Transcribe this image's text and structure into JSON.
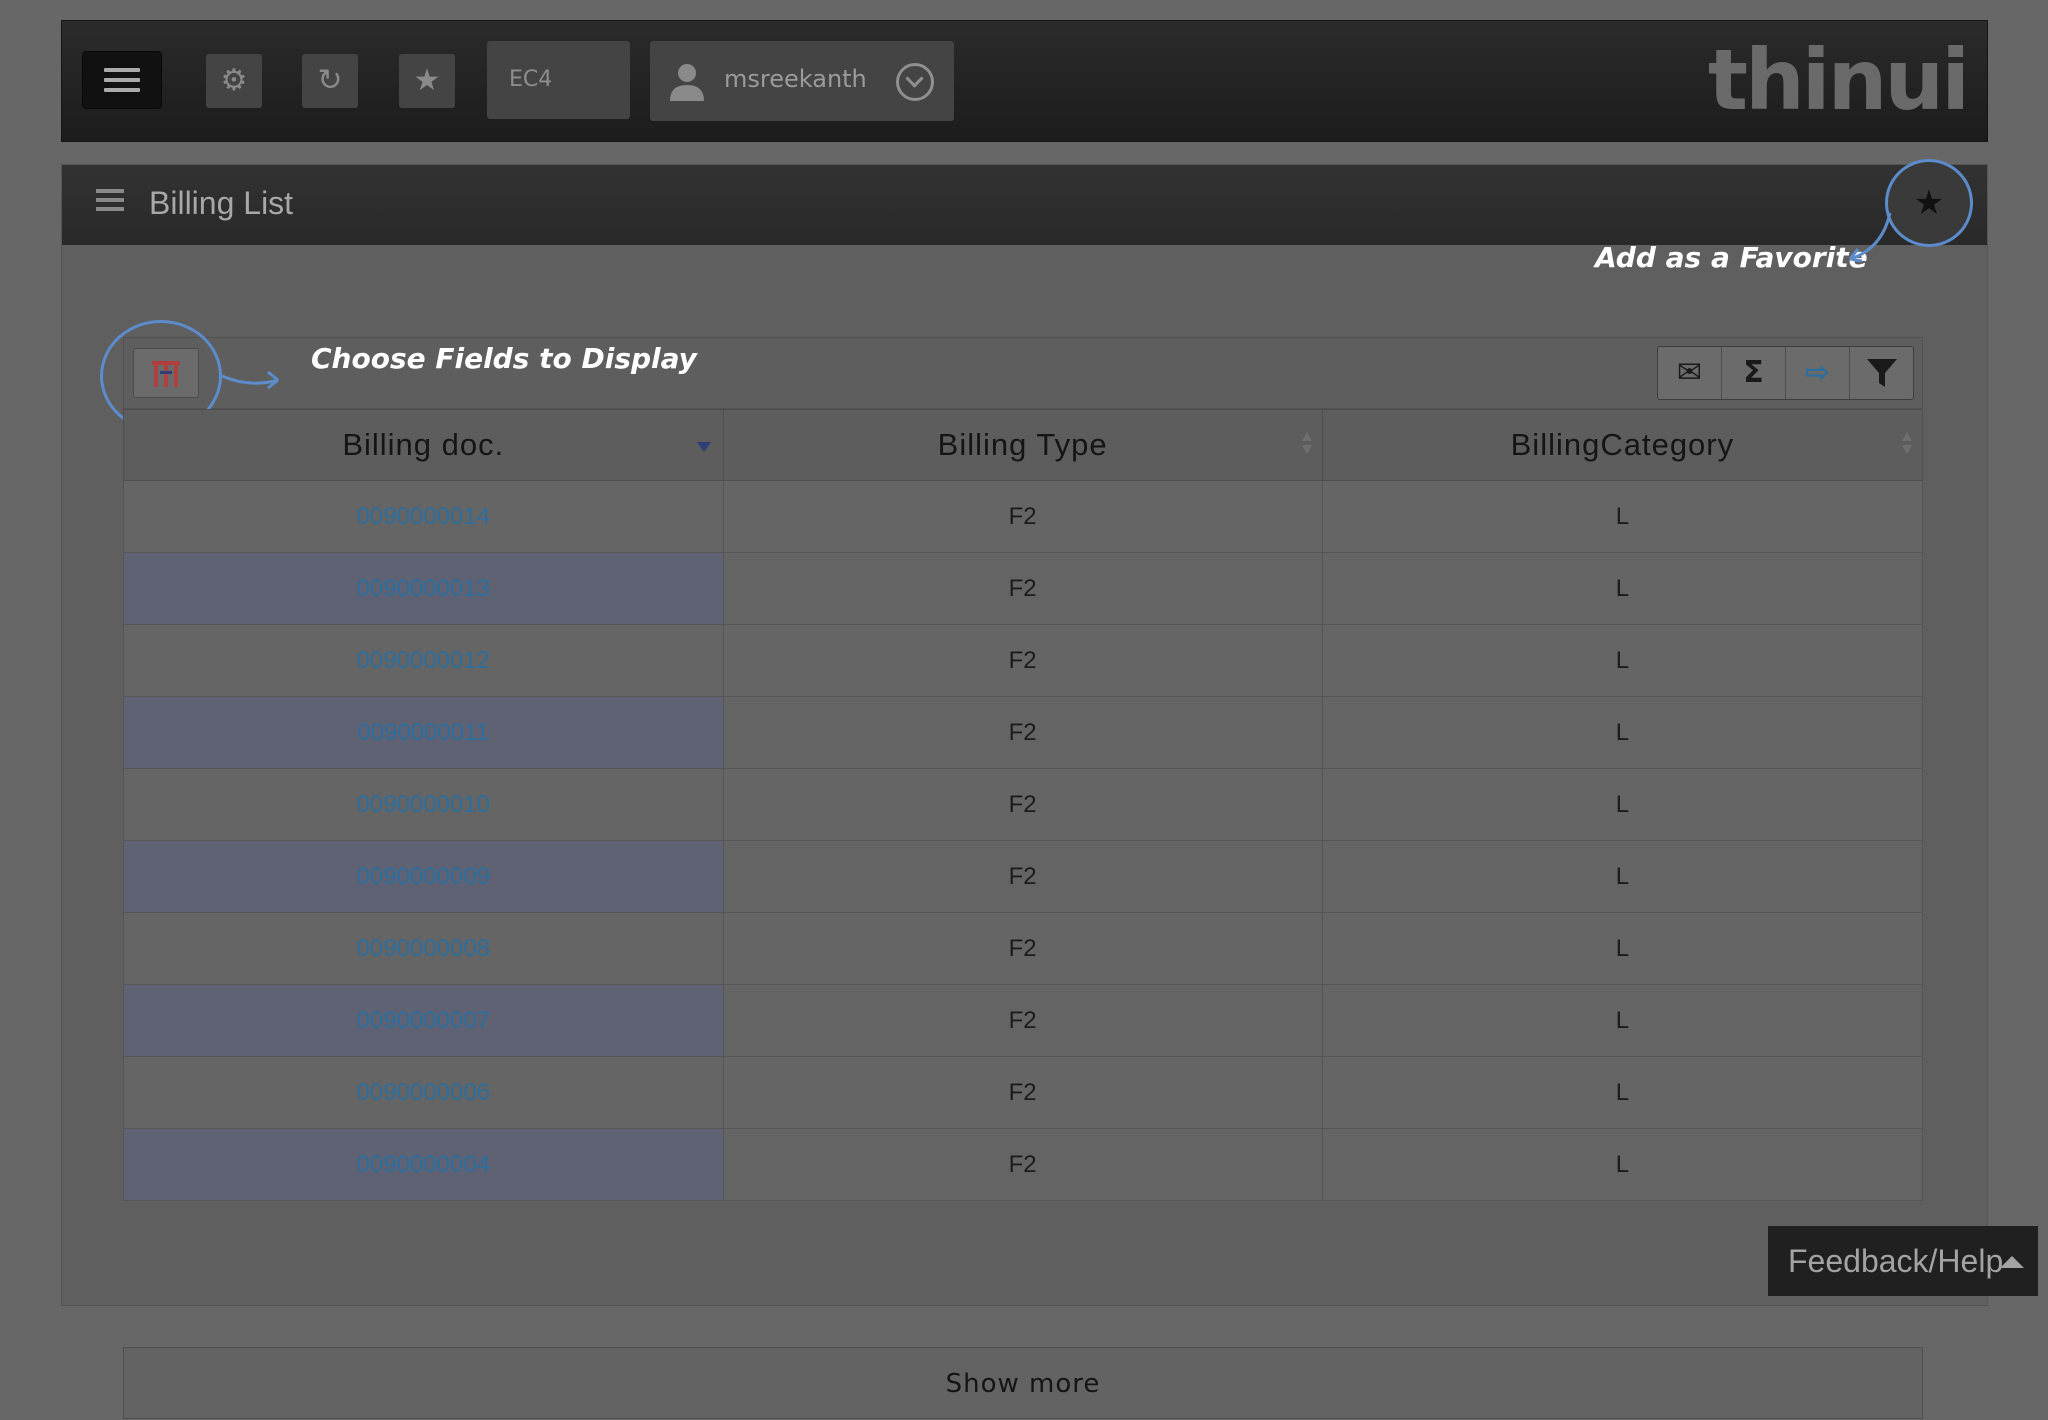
{
  "topbar": {
    "system": "EC4",
    "user": "msreekanth",
    "logo": "thinui",
    "icons": [
      "menu-icon",
      "gear-icon",
      "refresh-icon",
      "star-icon"
    ]
  },
  "panel": {
    "title": "Billing List",
    "favorite_annotation": "Add as a Favorite",
    "fields_annotation": "Choose Fields to Display"
  },
  "table": {
    "columns": [
      "Billing doc.",
      "Billing Type",
      "BillingCategory"
    ],
    "rows": [
      {
        "doc": "0090000014",
        "type": "F2",
        "category": "L"
      },
      {
        "doc": "0090000013",
        "type": "F2",
        "category": "L"
      },
      {
        "doc": "0090000012",
        "type": "F2",
        "category": "L"
      },
      {
        "doc": "0090000011",
        "type": "F2",
        "category": "L"
      },
      {
        "doc": "0090000010",
        "type": "F2",
        "category": "L"
      },
      {
        "doc": "0090000009",
        "type": "F2",
        "category": "L"
      },
      {
        "doc": "0090000008",
        "type": "F2",
        "category": "L"
      },
      {
        "doc": "0090000007",
        "type": "F2",
        "category": "L"
      },
      {
        "doc": "0090000006",
        "type": "F2",
        "category": "L"
      },
      {
        "doc": "0090000004",
        "type": "F2",
        "category": "L"
      }
    ],
    "show_more": "Show more"
  },
  "toolbar_icons": [
    "email-icon",
    "sum-icon",
    "export-icon",
    "filter-icon"
  ],
  "feedback": "Feedback/Help",
  "colors": {
    "link": "#2c6e9d",
    "annotation_circle": "#5d8ccd"
  }
}
